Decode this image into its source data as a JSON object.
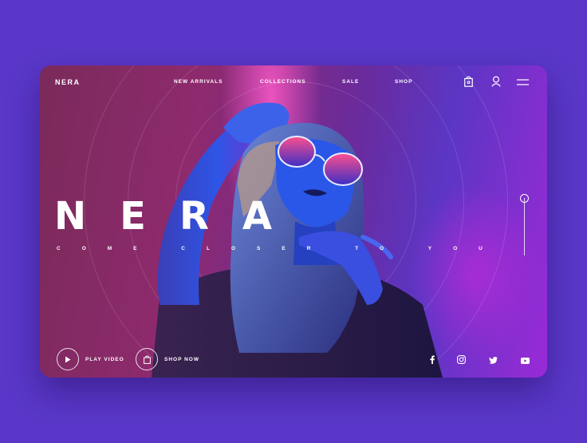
{
  "brand": {
    "logo": "NERA"
  },
  "nav": {
    "links": [
      "NEW ARRIVALS",
      "COLLECTIONS",
      "SALE",
      "SHOP"
    ],
    "icons": [
      "shopping-bag-icon",
      "user-icon",
      "menu-icon"
    ]
  },
  "hero": {
    "title": "NERA",
    "subtitle": "COME CLOSER TO YOU"
  },
  "actions": {
    "play_label": "PLAY VIDEO",
    "shop_label": "SHOP NOW"
  },
  "social": [
    "facebook-icon",
    "instagram-icon",
    "twitter-icon",
    "youtube-icon"
  ],
  "colors": {
    "page_background": "#5a37c8",
    "accent_pink": "#ff5ac8",
    "accent_blue": "#2a5cff",
    "text": "#ffffff"
  }
}
